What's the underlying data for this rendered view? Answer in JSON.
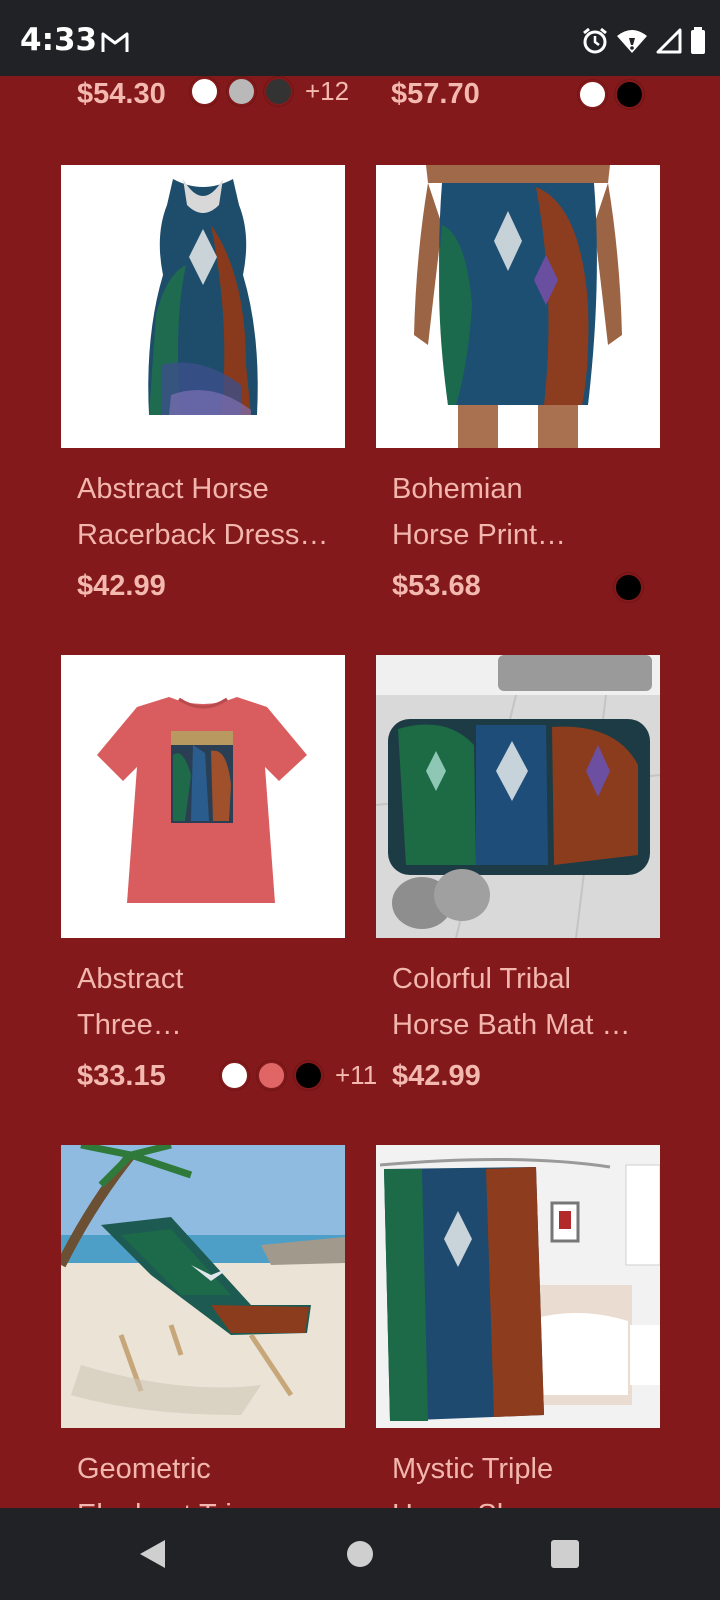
{
  "status": {
    "time": "4:33",
    "icons": [
      "gmail-icon",
      "alarm-icon",
      "wifi-icon",
      "signal-icon",
      "battery-icon"
    ]
  },
  "top_row": {
    "left": {
      "price": "$54.30",
      "swatches": [
        "#ffffff",
        "#b9b9b9",
        "#333333"
      ],
      "more": "+12"
    },
    "right": {
      "price": "$57.70",
      "swatches": [
        "#ffffff",
        "#000000"
      ]
    }
  },
  "products": [
    {
      "title_line1": "Abstract Horse",
      "title_line2": "Racerback Dress…",
      "price": "$42.99",
      "swatches": []
    },
    {
      "title_line1": "Bohemian",
      "title_line2": "Horse Print…",
      "price": "$53.68",
      "swatches": [
        "#000000"
      ]
    },
    {
      "title_line1": "Abstract",
      "title_line2": "Three…",
      "price": "$33.15",
      "swatches": [
        "#ffffff",
        "#e06666",
        "#000000"
      ],
      "more": "+11"
    },
    {
      "title_line1": "Colorful Tribal",
      "title_line2": "Horse Bath Mat …",
      "price": "$42.99",
      "swatches": []
    },
    {
      "title_line1": "Geometric",
      "title_line2": "Elephant Trio",
      "price": "",
      "swatches": []
    },
    {
      "title_line1": "Mystic Triple",
      "title_line2": "Horse Shower",
      "price": "",
      "swatches": []
    }
  ],
  "nav": {
    "back": "back-icon",
    "home": "home-icon",
    "recents": "recents-icon"
  },
  "colors": {
    "background": "#83191a",
    "text": "#f2b6ae",
    "bars": "#202226"
  }
}
